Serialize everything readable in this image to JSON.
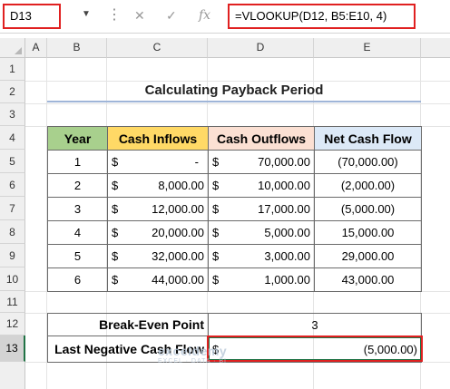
{
  "formula_bar": {
    "name_box": "D13",
    "formula": "=VLOOKUP(D12, B5:E10, 4)",
    "icons": [
      "cancel-icon",
      "enter-icon",
      "function-icon"
    ],
    "fx_label": "fx"
  },
  "columns": [
    "A",
    "B",
    "C",
    "D",
    "E"
  ],
  "rows": [
    "1",
    "2",
    "3",
    "4",
    "5",
    "6",
    "7",
    "8",
    "9",
    "10",
    "11",
    "12",
    "13"
  ],
  "selected_row": "13",
  "title": "Calculating Payback Period",
  "table": {
    "headers": [
      "Year",
      "Cash Inflows",
      "Cash Outflows",
      "Net Cash Flow"
    ],
    "rows": [
      {
        "year": "1",
        "inflow_sym": "$",
        "inflow": "-",
        "outflow_sym": "$",
        "outflow": "70,000.00",
        "net": "(70,000.00)"
      },
      {
        "year": "2",
        "inflow_sym": "$",
        "inflow": "8,000.00",
        "outflow_sym": "$",
        "outflow": "10,000.00",
        "net": "(2,000.00)"
      },
      {
        "year": "3",
        "inflow_sym": "$",
        "inflow": "12,000.00",
        "outflow_sym": "$",
        "outflow": "17,000.00",
        "net": "(5,000.00)"
      },
      {
        "year": "4",
        "inflow_sym": "$",
        "inflow": "20,000.00",
        "outflow_sym": "$",
        "outflow": "5,000.00",
        "net": "15,000.00"
      },
      {
        "year": "5",
        "inflow_sym": "$",
        "inflow": "32,000.00",
        "outflow_sym": "$",
        "outflow": "3,000.00",
        "net": "29,000.00"
      },
      {
        "year": "6",
        "inflow_sym": "$",
        "inflow": "44,000.00",
        "outflow_sym": "$",
        "outflow": "1,000.00",
        "net": "43,000.00"
      }
    ]
  },
  "summary": {
    "break_even_label": "Break-Even Point",
    "break_even_value": "3",
    "last_negative_label": "Last Negative Cash Flow",
    "last_negative_sym": "$",
    "last_negative_value": "(5,000.00)"
  },
  "watermark": {
    "name": "exceldemy",
    "tagline": "EXCEL · DATA · BI"
  }
}
